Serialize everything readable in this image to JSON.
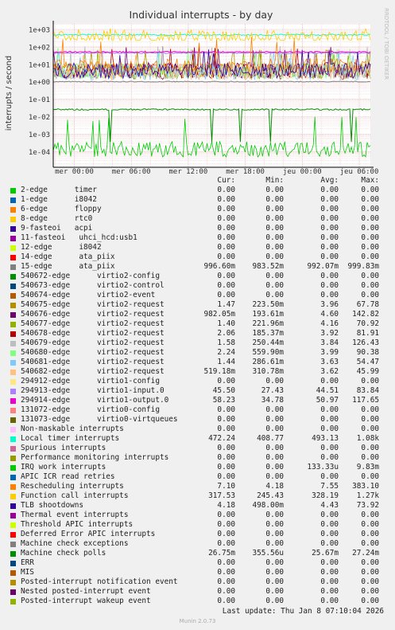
{
  "chart_data": {
    "type": "line",
    "title": "Individual interrupts - by day",
    "ylabel": "interrupts / second",
    "side_label": "RRDTOOL / TOBI OETIKER",
    "yscale": "log",
    "yticks": [
      "1e+03",
      "1e+02",
      "1e+01",
      "1e+00",
      "1e-01",
      "1e-02",
      "1e-03",
      "1e-04"
    ],
    "xticks": [
      "mer 00:00",
      "mer 06:00",
      "mer 12:00",
      "mer 18:00",
      "jeu 00:00",
      "jeu 06:00"
    ],
    "grid": true,
    "columns": [
      "Cur:",
      "Min:",
      "Avg:",
      "Max:"
    ],
    "series": [
      {
        "name": "2-edge      timer",
        "color": "#00cc00",
        "values": [
          "0.00",
          "0.00",
          "0.00",
          "0.00"
        ]
      },
      {
        "name": "1-edge      i8042",
        "color": "#0066b3",
        "values": [
          "0.00",
          "0.00",
          "0.00",
          "0.00"
        ]
      },
      {
        "name": "6-edge      floppy",
        "color": "#ff8000",
        "values": [
          "0.00",
          "0.00",
          "0.00",
          "0.00"
        ]
      },
      {
        "name": "8-edge      rtc0",
        "color": "#ffcc00",
        "values": [
          "0.00",
          "0.00",
          "0.00",
          "0.00"
        ]
      },
      {
        "name": "9-fasteoi   acpi",
        "color": "#330099",
        "values": [
          "0.00",
          "0.00",
          "0.00",
          "0.00"
        ]
      },
      {
        "name": "11-fasteoi   uhci_hcd:usb1",
        "color": "#990099",
        "values": [
          "0.00",
          "0.00",
          "0.00",
          "0.00"
        ]
      },
      {
        "name": "12-edge      i8042",
        "color": "#ccff00",
        "values": [
          "0.00",
          "0.00",
          "0.00",
          "0.00"
        ]
      },
      {
        "name": "14-edge      ata_piix",
        "color": "#ff0000",
        "values": [
          "0.00",
          "0.00",
          "0.00",
          "0.00"
        ]
      },
      {
        "name": "15-edge      ata_piix",
        "color": "#808080",
        "values": [
          "996.60m",
          "983.52m",
          "992.07m",
          "999.83m"
        ]
      },
      {
        "name": "540672-edge      virtio2-config",
        "color": "#008f00",
        "values": [
          "0.00",
          "0.00",
          "0.00",
          "0.00"
        ]
      },
      {
        "name": "540673-edge      virtio2-control",
        "color": "#00487d",
        "values": [
          "0.00",
          "0.00",
          "0.00",
          "0.00"
        ]
      },
      {
        "name": "540674-edge      virtio2-event",
        "color": "#b35a00",
        "values": [
          "0.00",
          "0.00",
          "0.00",
          "0.00"
        ]
      },
      {
        "name": "540675-edge      virtio2-request",
        "color": "#b38f00",
        "values": [
          "1.47",
          "223.50m",
          "3.96",
          "67.78"
        ]
      },
      {
        "name": "540676-edge      virtio2-request",
        "color": "#6b006b",
        "values": [
          "982.05m",
          "193.61m",
          "4.60",
          "142.82"
        ]
      },
      {
        "name": "540677-edge      virtio2-request",
        "color": "#8fb300",
        "values": [
          "1.40",
          "221.96m",
          "4.16",
          "70.92"
        ]
      },
      {
        "name": "540678-edge      virtio2-request",
        "color": "#b30000",
        "values": [
          "2.06",
          "185.37m",
          "3.92",
          "81.91"
        ]
      },
      {
        "name": "540679-edge      virtio2-request",
        "color": "#bebebe",
        "values": [
          "1.58",
          "250.44m",
          "3.84",
          "126.43"
        ]
      },
      {
        "name": "540680-edge      virtio2-request",
        "color": "#80ff80",
        "values": [
          "2.24",
          "559.90m",
          "3.99",
          "90.38"
        ]
      },
      {
        "name": "540681-edge      virtio2-request",
        "color": "#80c9ff",
        "values": [
          "1.44",
          "286.61m",
          "3.63",
          "54.47"
        ]
      },
      {
        "name": "540682-edge      virtio2-request",
        "color": "#ffc080",
        "values": [
          "519.18m",
          "310.78m",
          "3.62",
          "45.99"
        ]
      },
      {
        "name": "294912-edge      virtio1-config",
        "color": "#ffe680",
        "values": [
          "0.00",
          "0.00",
          "0.00",
          "0.00"
        ]
      },
      {
        "name": "294913-edge      virtio1-input.0",
        "color": "#aa80ff",
        "values": [
          "45.50",
          "27.43",
          "44.51",
          "83.84"
        ]
      },
      {
        "name": "294914-edge      virtio1-output.0",
        "color": "#ee00cc",
        "values": [
          "58.23",
          "34.78",
          "50.97",
          "117.65"
        ]
      },
      {
        "name": "131072-edge      virtio0-config",
        "color": "#ff8080",
        "values": [
          "0.00",
          "0.00",
          "0.00",
          "0.00"
        ]
      },
      {
        "name": "131073-edge      virtio0-virtqueues",
        "color": "#666600",
        "values": [
          "0.00",
          "0.00",
          "0.00",
          "0.00"
        ]
      },
      {
        "name": "Non-maskable interrupts",
        "color": "#ffbfff",
        "values": [
          "0.00",
          "0.00",
          "0.00",
          "0.00"
        ]
      },
      {
        "name": "Local timer interrupts",
        "color": "#00ffcc",
        "values": [
          "472.24",
          "408.77",
          "493.13",
          "1.08k"
        ]
      },
      {
        "name": "Spurious interrupts",
        "color": "#cc6699",
        "values": [
          "0.00",
          "0.00",
          "0.00",
          "0.00"
        ]
      },
      {
        "name": "Performance monitoring interrupts",
        "color": "#999900",
        "values": [
          "0.00",
          "0.00",
          "0.00",
          "0.00"
        ]
      },
      {
        "name": "IRQ work interrupts",
        "color": "#00cc00",
        "values": [
          "0.00",
          "0.00",
          "133.33u",
          "9.83m"
        ]
      },
      {
        "name": "APIC ICR read retries",
        "color": "#0066b3",
        "values": [
          "0.00",
          "0.00",
          "0.00",
          "0.00"
        ]
      },
      {
        "name": "Rescheduling interrupts",
        "color": "#ff8000",
        "values": [
          "7.10",
          "4.18",
          "7.55",
          "383.10"
        ]
      },
      {
        "name": "Function call interrupts",
        "color": "#ffcc00",
        "values": [
          "317.53",
          "245.43",
          "328.19",
          "1.27k"
        ]
      },
      {
        "name": "TLB shootdowns",
        "color": "#330099",
        "values": [
          "4.18",
          "498.00m",
          "4.43",
          "73.92"
        ]
      },
      {
        "name": "Thermal event interrupts",
        "color": "#990099",
        "values": [
          "0.00",
          "0.00",
          "0.00",
          "0.00"
        ]
      },
      {
        "name": "Threshold APIC interrupts",
        "color": "#ccff00",
        "values": [
          "0.00",
          "0.00",
          "0.00",
          "0.00"
        ]
      },
      {
        "name": "Deferred Error APIC interrupts",
        "color": "#ff0000",
        "values": [
          "0.00",
          "0.00",
          "0.00",
          "0.00"
        ]
      },
      {
        "name": "Machine check exceptions",
        "color": "#808080",
        "values": [
          "0.00",
          "0.00",
          "0.00",
          "0.00"
        ]
      },
      {
        "name": "Machine check polls",
        "color": "#008f00",
        "values": [
          "26.75m",
          "355.56u",
          "25.67m",
          "27.24m"
        ]
      },
      {
        "name": "ERR",
        "color": "#00487d",
        "values": [
          "0.00",
          "0.00",
          "0.00",
          "0.00"
        ]
      },
      {
        "name": "MIS",
        "color": "#b35a00",
        "values": [
          "0.00",
          "0.00",
          "0.00",
          "0.00"
        ]
      },
      {
        "name": "Posted-interrupt notification event",
        "color": "#b38f00",
        "values": [
          "0.00",
          "0.00",
          "0.00",
          "0.00"
        ]
      },
      {
        "name": "Nested posted-interrupt event",
        "color": "#6b006b",
        "values": [
          "0.00",
          "0.00",
          "0.00",
          "0.00"
        ]
      },
      {
        "name": "Posted-interrupt wakeup event",
        "color": "#8fb300",
        "values": [
          "0.00",
          "0.00",
          "0.00",
          "0.00"
        ]
      }
    ]
  },
  "last_update": "Last update:  Thu Jan  8 07:10:04 2026",
  "footer": "Munin 2.0.73"
}
